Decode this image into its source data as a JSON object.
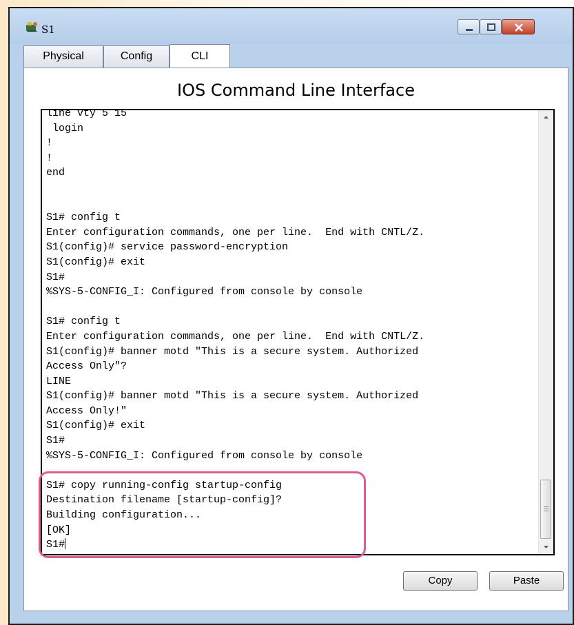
{
  "window": {
    "title": "S1"
  },
  "tabs": [
    {
      "label": "Physical"
    },
    {
      "label": "Config"
    },
    {
      "label": "CLI"
    }
  ],
  "panel": {
    "title": "IOS Command Line Interface"
  },
  "terminal": {
    "lines": [
      "line vty 5 15",
      " login",
      "!",
      "!",
      "end",
      "",
      "",
      "S1# config t",
      "Enter configuration commands, one per line.  End with CNTL/Z.",
      "S1(config)# service password-encryption",
      "S1(config)# exit",
      "S1#",
      "%SYS-5-CONFIG_I: Configured from console by console",
      "",
      "S1# config t",
      "Enter configuration commands, one per line.  End with CNTL/Z.",
      "S1(config)# banner motd \"This is a secure system. Authorized",
      "Access Only\"?",
      "LINE",
      "S1(config)# banner motd \"This is a secure system. Authorized",
      "Access Only!\"",
      "S1(config)# exit",
      "S1#",
      "%SYS-5-CONFIG_I: Configured from console by console",
      "",
      "S1# copy running-config startup-config",
      "Destination filename [startup-config]?",
      "Building configuration...",
      "[OK]",
      "S1#"
    ]
  },
  "buttons": {
    "copy": "Copy",
    "paste": "Paste"
  }
}
